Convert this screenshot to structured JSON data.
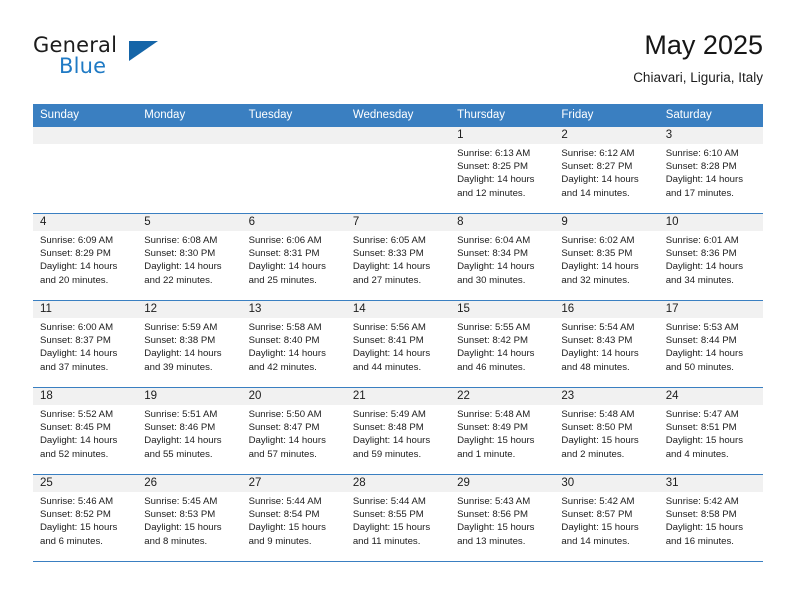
{
  "brand": {
    "line1": "General",
    "line2": "Blue",
    "accent_color": "#1f7ac4",
    "triangle_color": "#1565a8"
  },
  "header": {
    "title": "May 2025",
    "subtitle": "Chiavari, Liguria, Italy"
  },
  "theme": {
    "header_row_bg": "#3a7fc1",
    "daynum_band_bg": "#f1f1f1",
    "grid_line": "#3a7fc1",
    "text": "#1c1c1c"
  },
  "weekdays": [
    "Sunday",
    "Monday",
    "Tuesday",
    "Wednesday",
    "Thursday",
    "Friday",
    "Saturday"
  ],
  "labels": {
    "sunrise_prefix": "Sunrise: ",
    "sunset_prefix": "Sunset: ",
    "daylight_prefix": "Daylight: "
  },
  "weeks": [
    [
      {
        "empty": true
      },
      {
        "empty": true
      },
      {
        "empty": true
      },
      {
        "empty": true
      },
      {
        "day": "1",
        "sunrise": "Sunrise: 6:13 AM",
        "sunset": "Sunset: 8:25 PM",
        "daylight_l1": "Daylight: 14 hours",
        "daylight_l2": "and 12 minutes."
      },
      {
        "day": "2",
        "sunrise": "Sunrise: 6:12 AM",
        "sunset": "Sunset: 8:27 PM",
        "daylight_l1": "Daylight: 14 hours",
        "daylight_l2": "and 14 minutes."
      },
      {
        "day": "3",
        "sunrise": "Sunrise: 6:10 AM",
        "sunset": "Sunset: 8:28 PM",
        "daylight_l1": "Daylight: 14 hours",
        "daylight_l2": "and 17 minutes."
      }
    ],
    [
      {
        "day": "4",
        "sunrise": "Sunrise: 6:09 AM",
        "sunset": "Sunset: 8:29 PM",
        "daylight_l1": "Daylight: 14 hours",
        "daylight_l2": "and 20 minutes."
      },
      {
        "day": "5",
        "sunrise": "Sunrise: 6:08 AM",
        "sunset": "Sunset: 8:30 PM",
        "daylight_l1": "Daylight: 14 hours",
        "daylight_l2": "and 22 minutes."
      },
      {
        "day": "6",
        "sunrise": "Sunrise: 6:06 AM",
        "sunset": "Sunset: 8:31 PM",
        "daylight_l1": "Daylight: 14 hours",
        "daylight_l2": "and 25 minutes."
      },
      {
        "day": "7",
        "sunrise": "Sunrise: 6:05 AM",
        "sunset": "Sunset: 8:33 PM",
        "daylight_l1": "Daylight: 14 hours",
        "daylight_l2": "and 27 minutes."
      },
      {
        "day": "8",
        "sunrise": "Sunrise: 6:04 AM",
        "sunset": "Sunset: 8:34 PM",
        "daylight_l1": "Daylight: 14 hours",
        "daylight_l2": "and 30 minutes."
      },
      {
        "day": "9",
        "sunrise": "Sunrise: 6:02 AM",
        "sunset": "Sunset: 8:35 PM",
        "daylight_l1": "Daylight: 14 hours",
        "daylight_l2": "and 32 minutes."
      },
      {
        "day": "10",
        "sunrise": "Sunrise: 6:01 AM",
        "sunset": "Sunset: 8:36 PM",
        "daylight_l1": "Daylight: 14 hours",
        "daylight_l2": "and 34 minutes."
      }
    ],
    [
      {
        "day": "11",
        "sunrise": "Sunrise: 6:00 AM",
        "sunset": "Sunset: 8:37 PM",
        "daylight_l1": "Daylight: 14 hours",
        "daylight_l2": "and 37 minutes."
      },
      {
        "day": "12",
        "sunrise": "Sunrise: 5:59 AM",
        "sunset": "Sunset: 8:38 PM",
        "daylight_l1": "Daylight: 14 hours",
        "daylight_l2": "and 39 minutes."
      },
      {
        "day": "13",
        "sunrise": "Sunrise: 5:58 AM",
        "sunset": "Sunset: 8:40 PM",
        "daylight_l1": "Daylight: 14 hours",
        "daylight_l2": "and 42 minutes."
      },
      {
        "day": "14",
        "sunrise": "Sunrise: 5:56 AM",
        "sunset": "Sunset: 8:41 PM",
        "daylight_l1": "Daylight: 14 hours",
        "daylight_l2": "and 44 minutes."
      },
      {
        "day": "15",
        "sunrise": "Sunrise: 5:55 AM",
        "sunset": "Sunset: 8:42 PM",
        "daylight_l1": "Daylight: 14 hours",
        "daylight_l2": "and 46 minutes."
      },
      {
        "day": "16",
        "sunrise": "Sunrise: 5:54 AM",
        "sunset": "Sunset: 8:43 PM",
        "daylight_l1": "Daylight: 14 hours",
        "daylight_l2": "and 48 minutes."
      },
      {
        "day": "17",
        "sunrise": "Sunrise: 5:53 AM",
        "sunset": "Sunset: 8:44 PM",
        "daylight_l1": "Daylight: 14 hours",
        "daylight_l2": "and 50 minutes."
      }
    ],
    [
      {
        "day": "18",
        "sunrise": "Sunrise: 5:52 AM",
        "sunset": "Sunset: 8:45 PM",
        "daylight_l1": "Daylight: 14 hours",
        "daylight_l2": "and 52 minutes."
      },
      {
        "day": "19",
        "sunrise": "Sunrise: 5:51 AM",
        "sunset": "Sunset: 8:46 PM",
        "daylight_l1": "Daylight: 14 hours",
        "daylight_l2": "and 55 minutes."
      },
      {
        "day": "20",
        "sunrise": "Sunrise: 5:50 AM",
        "sunset": "Sunset: 8:47 PM",
        "daylight_l1": "Daylight: 14 hours",
        "daylight_l2": "and 57 minutes."
      },
      {
        "day": "21",
        "sunrise": "Sunrise: 5:49 AM",
        "sunset": "Sunset: 8:48 PM",
        "daylight_l1": "Daylight: 14 hours",
        "daylight_l2": "and 59 minutes."
      },
      {
        "day": "22",
        "sunrise": "Sunrise: 5:48 AM",
        "sunset": "Sunset: 8:49 PM",
        "daylight_l1": "Daylight: 15 hours",
        "daylight_l2": "and 1 minute."
      },
      {
        "day": "23",
        "sunrise": "Sunrise: 5:48 AM",
        "sunset": "Sunset: 8:50 PM",
        "daylight_l1": "Daylight: 15 hours",
        "daylight_l2": "and 2 minutes."
      },
      {
        "day": "24",
        "sunrise": "Sunrise: 5:47 AM",
        "sunset": "Sunset: 8:51 PM",
        "daylight_l1": "Daylight: 15 hours",
        "daylight_l2": "and 4 minutes."
      }
    ],
    [
      {
        "day": "25",
        "sunrise": "Sunrise: 5:46 AM",
        "sunset": "Sunset: 8:52 PM",
        "daylight_l1": "Daylight: 15 hours",
        "daylight_l2": "and 6 minutes."
      },
      {
        "day": "26",
        "sunrise": "Sunrise: 5:45 AM",
        "sunset": "Sunset: 8:53 PM",
        "daylight_l1": "Daylight: 15 hours",
        "daylight_l2": "and 8 minutes."
      },
      {
        "day": "27",
        "sunrise": "Sunrise: 5:44 AM",
        "sunset": "Sunset: 8:54 PM",
        "daylight_l1": "Daylight: 15 hours",
        "daylight_l2": "and 9 minutes."
      },
      {
        "day": "28",
        "sunrise": "Sunrise: 5:44 AM",
        "sunset": "Sunset: 8:55 PM",
        "daylight_l1": "Daylight: 15 hours",
        "daylight_l2": "and 11 minutes."
      },
      {
        "day": "29",
        "sunrise": "Sunrise: 5:43 AM",
        "sunset": "Sunset: 8:56 PM",
        "daylight_l1": "Daylight: 15 hours",
        "daylight_l2": "and 13 minutes."
      },
      {
        "day": "30",
        "sunrise": "Sunrise: 5:42 AM",
        "sunset": "Sunset: 8:57 PM",
        "daylight_l1": "Daylight: 15 hours",
        "daylight_l2": "and 14 minutes."
      },
      {
        "day": "31",
        "sunrise": "Sunrise: 5:42 AM",
        "sunset": "Sunset: 8:58 PM",
        "daylight_l1": "Daylight: 15 hours",
        "daylight_l2": "and 16 minutes."
      }
    ]
  ]
}
